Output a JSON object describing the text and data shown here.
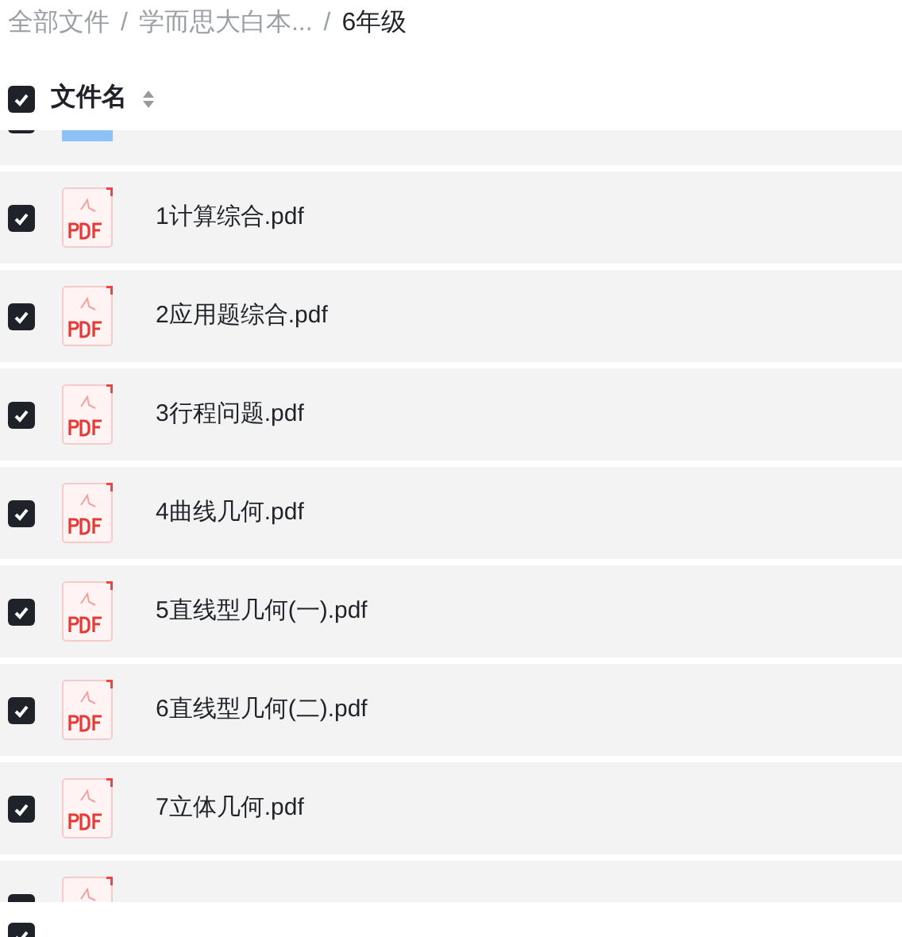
{
  "breadcrumb": [
    {
      "label": "全部文件",
      "current": false
    },
    {
      "label": "学而思大白本...",
      "current": false,
      "separator": "/"
    },
    {
      "label": "6年级",
      "current": true,
      "separator": "/"
    }
  ],
  "header": {
    "checked": true,
    "label": "文件名"
  },
  "rows": [
    {
      "kind": "folder",
      "checked": true
    },
    {
      "kind": "pdf",
      "checked": true,
      "name": "1计算综合.pdf"
    },
    {
      "kind": "pdf",
      "checked": true,
      "name": "2应用题综合.pdf"
    },
    {
      "kind": "pdf",
      "checked": true,
      "name": "3行程问题.pdf"
    },
    {
      "kind": "pdf",
      "checked": true,
      "name": "4曲线几何.pdf"
    },
    {
      "kind": "pdf",
      "checked": true,
      "name": "5直线型几何(一).pdf"
    },
    {
      "kind": "pdf",
      "checked": true,
      "name": "6直线型几何(二).pdf"
    },
    {
      "kind": "pdf",
      "checked": true,
      "name": "7立体几何.pdf"
    },
    {
      "kind": "pdf",
      "checked": true
    }
  ],
  "footer": {
    "checked": true
  }
}
